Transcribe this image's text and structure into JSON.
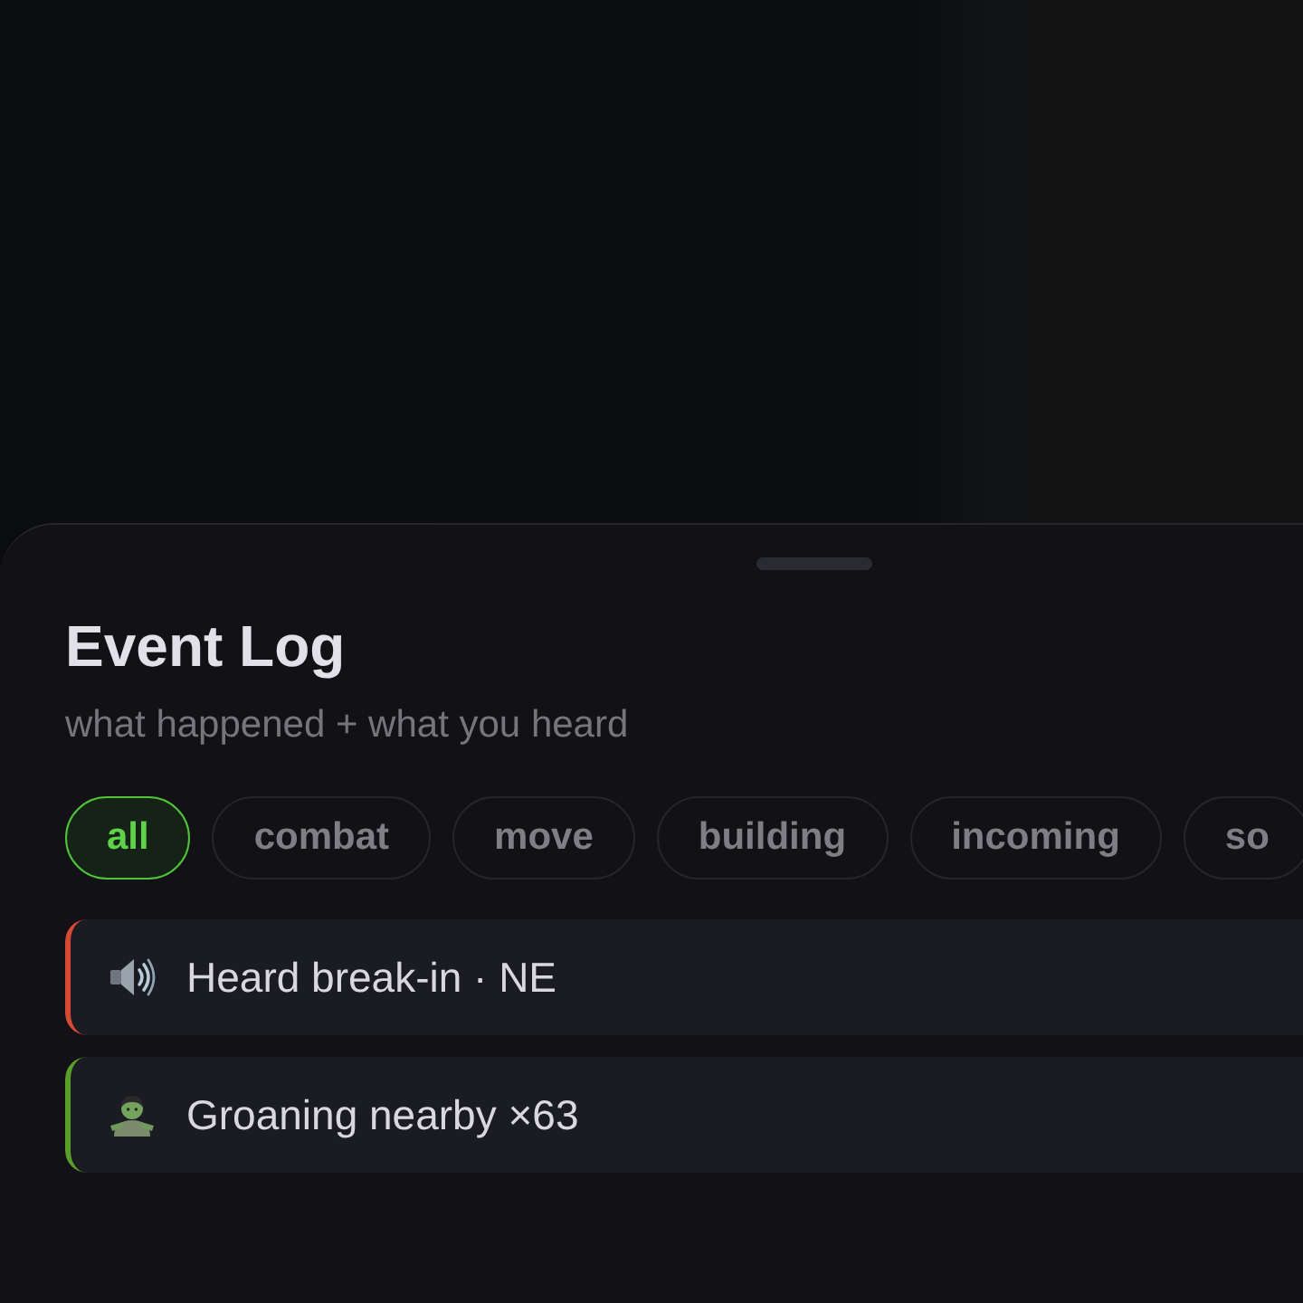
{
  "sheet": {
    "title": "Event Log",
    "subtitle": "what happened + what you heard"
  },
  "filters": [
    {
      "label": "all",
      "selected": true
    },
    {
      "label": "combat",
      "selected": false
    },
    {
      "label": "move",
      "selected": false
    },
    {
      "label": "building",
      "selected": false
    },
    {
      "label": "incoming",
      "selected": false
    },
    {
      "label": "so",
      "selected": false
    }
  ],
  "events": [
    {
      "kind": "sound",
      "text": "Heard break-in · NE",
      "color": "#d64a35"
    },
    {
      "kind": "zombie",
      "text": "Groaning nearby ×63",
      "color": "#5a9e2a"
    }
  ]
}
